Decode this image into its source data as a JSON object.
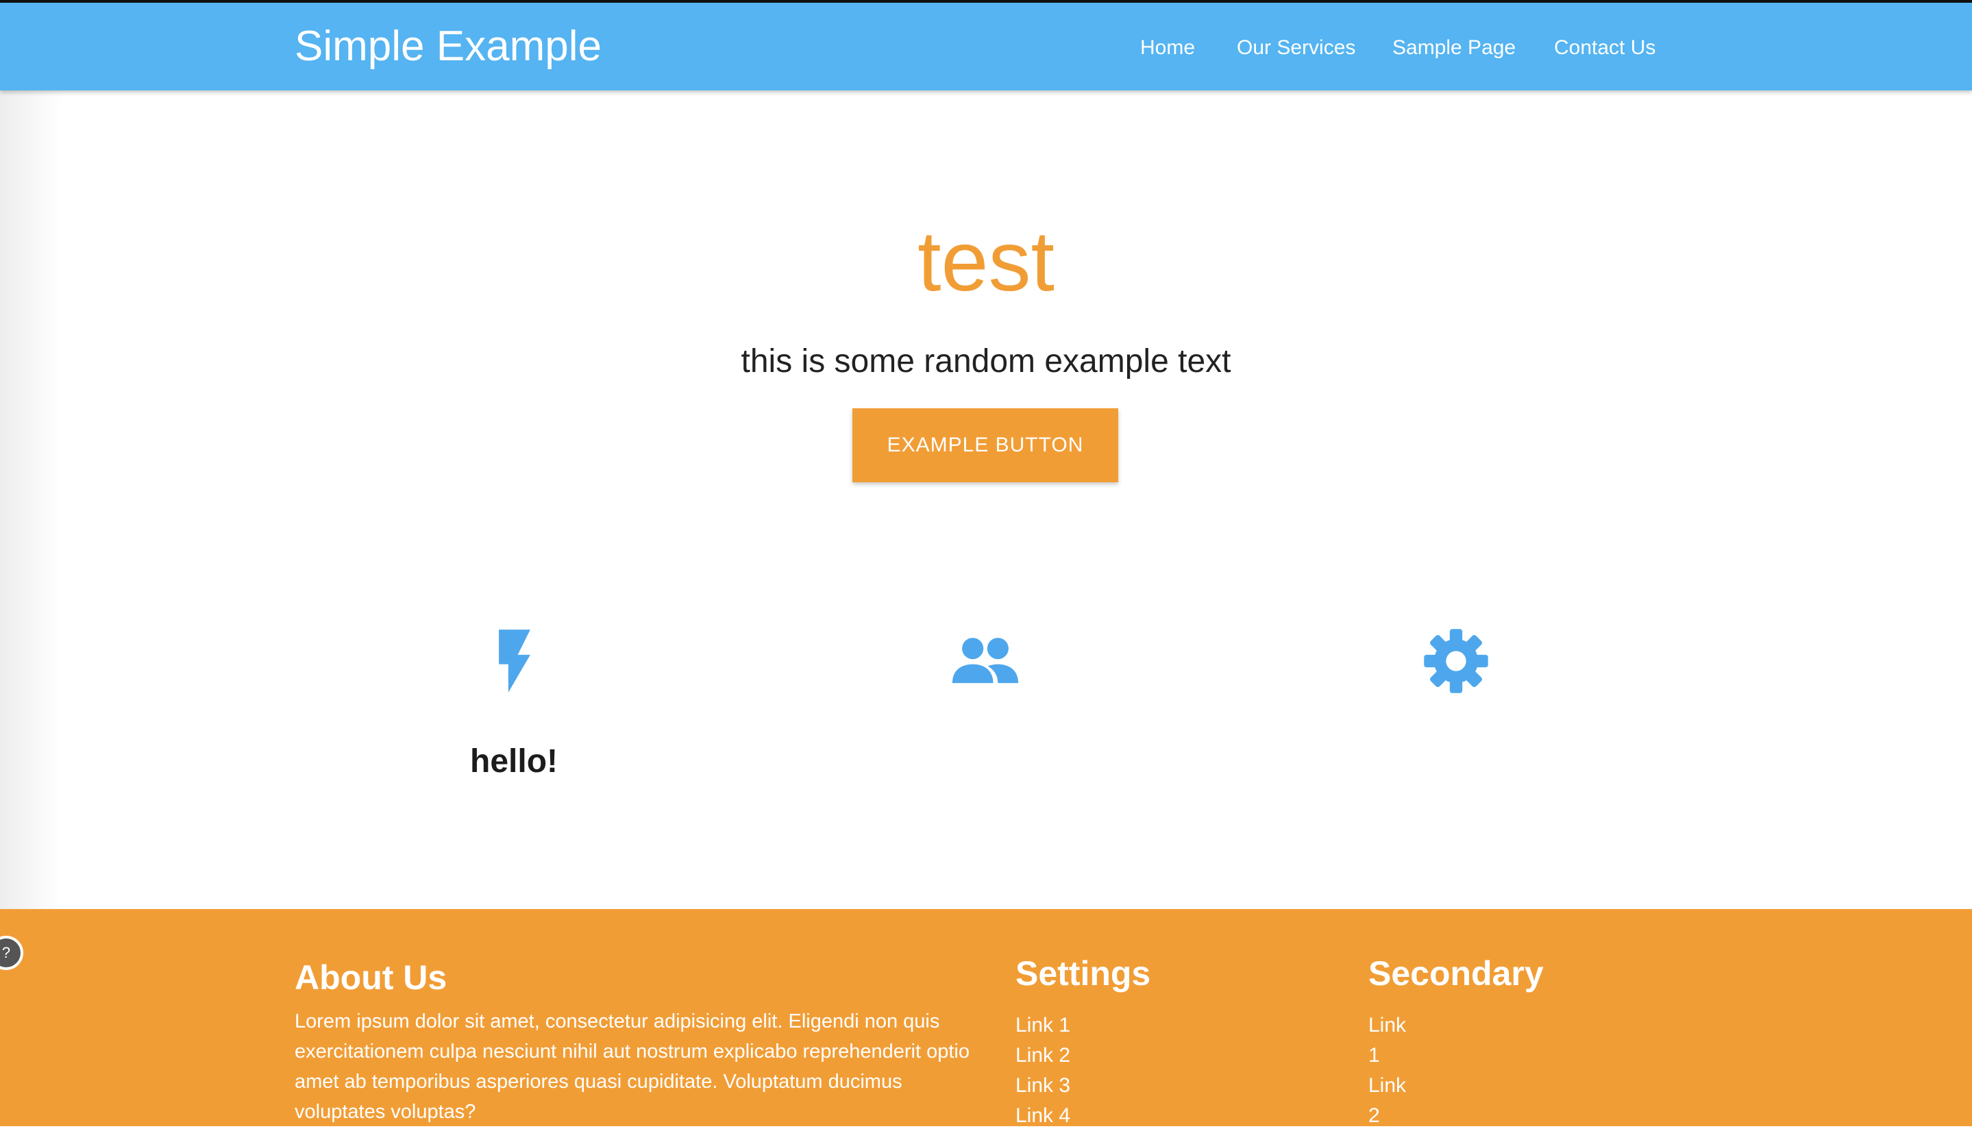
{
  "header": {
    "brand": "Simple Example",
    "nav": [
      "Home",
      "Our Services",
      "Sample Page",
      "Contact Us"
    ]
  },
  "hero": {
    "title": "test",
    "subtitle": "this is some random example text",
    "button_label": "EXAMPLE BUTTON"
  },
  "features": {
    "icons": [
      "flash-icon",
      "people-icon",
      "gear-icon"
    ],
    "heading": "hello!"
  },
  "footer": {
    "about_title": "About Us",
    "about_text": "Lorem ipsum dolor sit amet, consectetur adipisicing elit. Eligendi non quis exercitationem culpa nesciunt nihil aut nostrum explicabo reprehenderit optio amet ab temporibus asperiores quasi cupiditate. Voluptatum ducimus voluptates voluptas?",
    "settings_title": "Settings",
    "settings_links": [
      "Link 1",
      "Link 2",
      "Link 3",
      "Link 4"
    ],
    "secondary_title": "Secondary",
    "secondary_links": [
      "Link 1",
      "Link 2"
    ]
  },
  "colors": {
    "navbar": "#55b4f1",
    "accent": "#f19d36",
    "icon": "#4ea7ec"
  }
}
